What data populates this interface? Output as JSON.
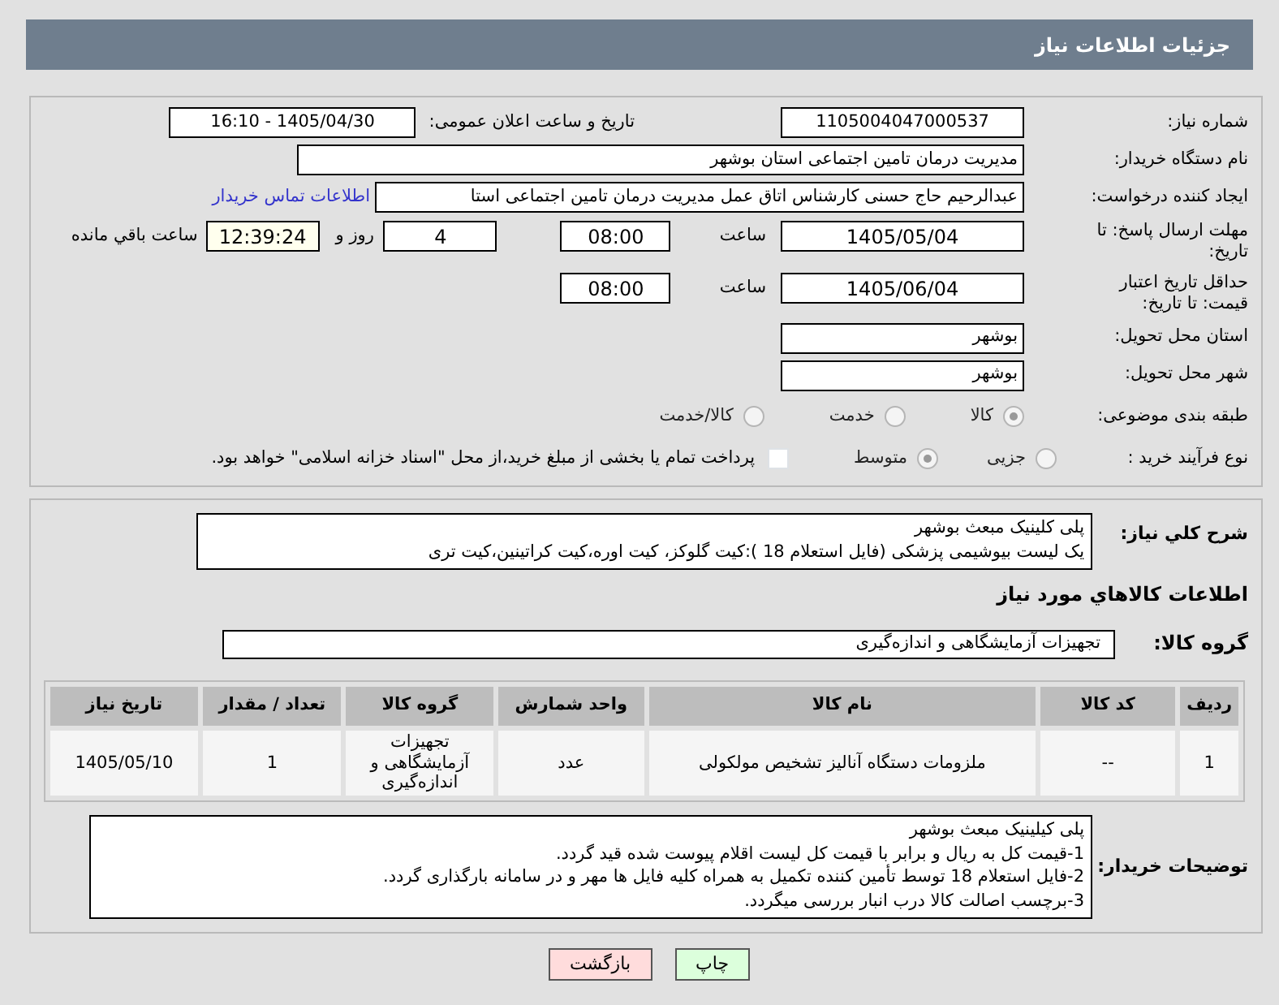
{
  "header": {
    "title": "جزئیات اطلاعات نیاز"
  },
  "form": {
    "need_number": {
      "label": "شماره نیاز:",
      "value": "1105004047000537"
    },
    "announce": {
      "label": "تاریخ و ساعت اعلان عمومی:",
      "value": "1405/04/30 - 16:10"
    },
    "buyer_org": {
      "label": "نام دستگاه خریدار:",
      "value": "مدیریت درمان تامین اجتماعی استان بوشهر"
    },
    "creator": {
      "label": "ایجاد کننده درخواست:",
      "value": "عبدالرحیم حاج حسنی کارشناس اتاق عمل مدیریت درمان تامین اجتماعی استا",
      "link": "اطلاعات تماس خریدار"
    },
    "deadline": {
      "label": "مهلت ارسال پاسخ: تا تاریخ:",
      "date": "1405/05/04",
      "time_label": "ساعت",
      "time": "08:00",
      "days": "4",
      "days_label": "روز و",
      "remaining": "12:39:24",
      "remaining_label": "ساعت باقي مانده"
    },
    "validity": {
      "label": "حداقل تاریخ اعتبار قیمت: تا تاریخ:",
      "date": "1405/06/04",
      "time_label": "ساعت",
      "time": "08:00"
    },
    "province": {
      "label": "استان محل تحویل:",
      "value": "بوشهر"
    },
    "city": {
      "label": "شهر محل تحویل:",
      "value": "بوشهر"
    },
    "category": {
      "label": "طبقه بندی موضوعی:",
      "options": [
        {
          "label": "کالا",
          "selected": true
        },
        {
          "label": "خدمت",
          "selected": false
        },
        {
          "label": "کالا/خدمت",
          "selected": false
        }
      ]
    },
    "process": {
      "label": "نوع فرآیند خرید :",
      "options": [
        {
          "label": "جزیی",
          "selected": false
        },
        {
          "label": "متوسط",
          "selected": true
        }
      ],
      "treasury": {
        "checked": false,
        "text": "پرداخت تمام یا بخشی از مبلغ خرید،از محل \"اسناد خزانه اسلامی\" خواهد بود."
      }
    }
  },
  "description": {
    "label": "شرح کلي نياز:",
    "lines": [
      "پلی کلینیک مبعث بوشهر",
      "یک لیست بیوشیمی پزشکی (فایل استعلام 18 ):کیت گلوکز، کیت اوره،کیت کراتینین،کیت تری"
    ]
  },
  "goods": {
    "title": "اطلاعات کالاهاي مورد نياز",
    "group_label": "گروه کالا:",
    "group": "تجهیزات آزمایشگاهی و اندازه‌گیری",
    "table": {
      "columns": [
        "ردیف",
        "کد کالا",
        "نام کالا",
        "واحد شمارش",
        "گروه کالا",
        "تعداد / مقدار",
        "تاریخ نیاز"
      ],
      "rows": [
        [
          "1",
          "--",
          "ملزومات دستگاه آنالیز تشخیص مولکولی",
          "عدد",
          "تجهیزات آزمایشگاهی و اندازه‌گیری",
          "1",
          "1405/05/10"
        ]
      ]
    }
  },
  "notes": {
    "label": "توضیحات خریدار:",
    "lines": [
      "پلی کیلینیک مبعث بوشهر",
      "1-قیمت کل به ریال و برابر با قیمت کل لیست اقلام پیوست شده قید گردد.",
      "2-فایل استعلام 18 توسط تأمین کننده تکمیل به همراه کلیه فایل ها مهر و در سامانه بارگذاری گردد.",
      "3-برچسب اصالت کالا درب انبار بررسی میگردد."
    ]
  },
  "buttons": [
    {
      "label": "چاپ",
      "kind": "print"
    },
    {
      "label": "بازگشت",
      "kind": "back"
    }
  ]
}
